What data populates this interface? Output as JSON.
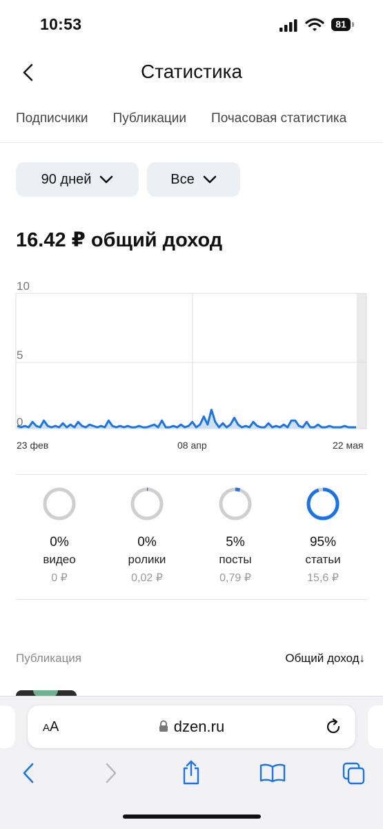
{
  "status_bar": {
    "time": "10:53",
    "battery": "81"
  },
  "header": {
    "title": "Статистика"
  },
  "tabs": [
    {
      "label": "Подписчики"
    },
    {
      "label": "Публикации"
    },
    {
      "label": "Почасовая статистика"
    }
  ],
  "filters": {
    "period": "90 дней",
    "type": "Все"
  },
  "income": {
    "summary": "16.42 ₽ общий доход"
  },
  "chart_data": {
    "type": "area",
    "ylim": [
      0,
      10
    ],
    "y_ticks": [
      "10",
      "5",
      "0"
    ],
    "x_tick_labels": [
      "23 фев",
      "08 апр",
      "22 мая"
    ],
    "values": [
      0.2,
      0.1,
      0.2,
      0.1,
      0.5,
      0.2,
      0.1,
      0.6,
      0.2,
      0.1,
      0.2,
      0.1,
      0.4,
      0.1,
      0.3,
      0.1,
      0.5,
      0.2,
      0.1,
      0.3,
      0.2,
      0.1,
      0.2,
      0.1,
      0.6,
      0.2,
      0.1,
      0.2,
      0.1,
      0.2,
      0.1,
      0.1,
      0.2,
      0.1,
      0.1,
      0.2,
      0.3,
      0.1,
      0.6,
      0.1,
      0.1,
      0.2,
      0.1,
      0.3,
      0.1,
      0.2,
      0.5,
      0.1,
      0.3,
      0.9,
      0.3,
      1.4,
      0.5,
      0.1,
      0.4,
      0.1,
      0.3,
      0.8,
      0.3,
      0.1,
      0.2,
      0.1,
      0.5,
      0.2,
      0.1,
      0.1,
      0.4,
      0.1,
      0.2,
      0.1,
      0.3,
      0.1,
      0.6,
      0.6,
      0.2,
      0.1,
      0.5,
      0.1,
      0.1,
      0.3,
      0.1,
      0.1,
      0.2,
      0.1,
      0.1,
      0.1,
      0.2,
      0.1,
      0.1,
      0.1
    ]
  },
  "breakdown": [
    {
      "percent": "0%",
      "category": "видео",
      "amount": "0 ₽",
      "fraction": 0,
      "color": "#cfcfcf"
    },
    {
      "percent": "0%",
      "category": "ролики",
      "amount": "0,02 ₽",
      "fraction": 0.01,
      "color": "#cfcfcf"
    },
    {
      "percent": "5%",
      "category": "посты",
      "amount": "0,79 ₽",
      "fraction": 0.05,
      "color": "#cfcfcf"
    },
    {
      "percent": "95%",
      "category": "статьи",
      "amount": "15,6 ₽",
      "fraction": 0.95,
      "color": "#cfcfcf"
    }
  ],
  "accent_color": "#1a73e8",
  "publications": {
    "column_label": "Публикация",
    "sort_label": "Общий доход↓"
  },
  "browser": {
    "aa_small": "A",
    "aa_large": "A",
    "url": "dzen.ru"
  },
  "icons": {
    "back": "chevron-left-icon",
    "reload": "reload-icon",
    "lock": "lock-icon",
    "share": "share-icon",
    "bookmarks": "book-icon",
    "tabs": "tabs-icon"
  }
}
